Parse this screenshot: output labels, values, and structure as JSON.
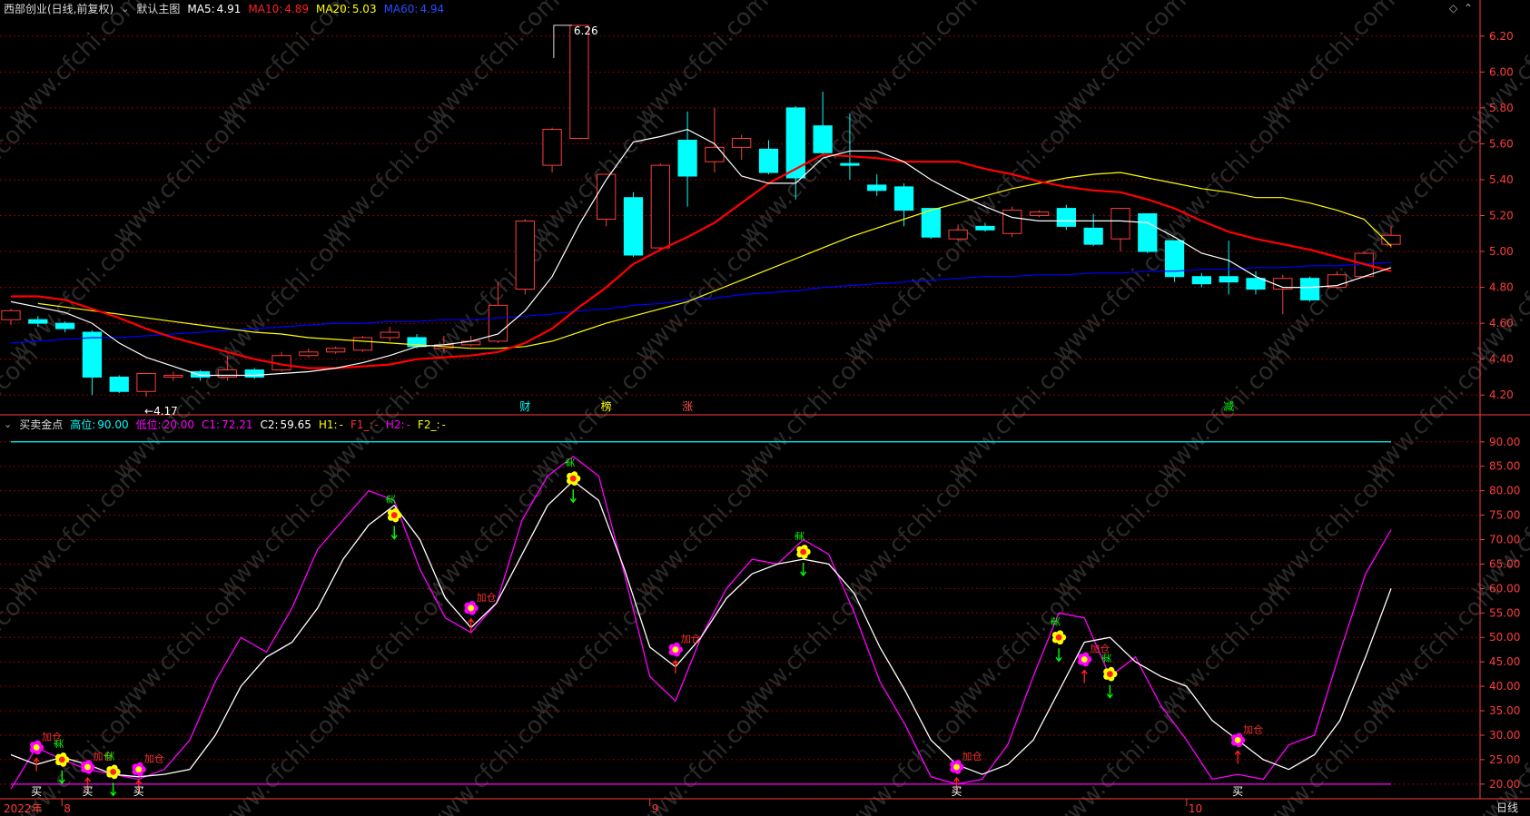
{
  "top_header": {
    "title": "西部创业(日线,前复权)",
    "chart_name": "默认主图",
    "ma5_label": "MA5:",
    "ma5_value": "4.91",
    "ma10_label": "MA10:",
    "ma10_value": "4.89",
    "ma20_label": "MA20:",
    "ma20_value": "5.03",
    "ma60_label": "MA60:",
    "ma60_value": "4.94"
  },
  "bottom_header": {
    "indicator_name": "买卖金点",
    "high_label": "高位:",
    "high_value": "90.00",
    "low_label": "低位:",
    "low_value": "20.00",
    "c1_label": "C1:",
    "c1_value": "72.21",
    "c2_label": "C2:",
    "c2_value": "59.65",
    "h1_label": "H1:",
    "h1_value": "-",
    "f1_label": "F1_:",
    "f1_value": "-",
    "h2_label": "H2:",
    "h2_value": "-",
    "f2_label": "F2_:",
    "f2_value": "-"
  },
  "colors": {
    "up": "#ff3c3c",
    "down": "#00ffff",
    "ma5": "#ffffff",
    "ma10": "#ff0000",
    "ma20": "#ffff00",
    "ma60": "#0000ff",
    "c1": "#ff00ff",
    "c2": "#ffffff",
    "high_line": "#00ffff",
    "low_line": "#ff00ff",
    "grid": "#8b0000",
    "axis": "#ff3c3c"
  },
  "chart_data": [
    {
      "type": "candlestick",
      "yaxis_ticks": [
        "6.20",
        "6.00",
        "5.80",
        "5.60",
        "5.40",
        "5.20",
        "5.00",
        "4.80",
        "4.60",
        "4.40",
        "4.20"
      ],
      "ylim": [
        4.1,
        6.3
      ],
      "max_annotation": "6.26",
      "min_annotation": "4.17",
      "candles": [
        [
          4.62,
          4.67,
          4.59,
          4.68
        ],
        [
          4.62,
          4.6,
          4.58,
          4.64
        ],
        [
          4.6,
          4.57,
          4.55,
          4.61
        ],
        [
          4.55,
          4.3,
          4.2,
          4.56
        ],
        [
          4.3,
          4.22,
          4.21,
          4.31
        ],
        [
          4.22,
          4.32,
          4.19,
          4.32
        ],
        [
          4.3,
          4.31,
          4.28,
          4.33
        ],
        [
          4.33,
          4.3,
          4.28,
          4.34
        ],
        [
          4.3,
          4.34,
          4.28,
          4.42
        ],
        [
          4.34,
          4.3,
          4.29,
          4.35
        ],
        [
          4.34,
          4.42,
          4.33,
          4.44
        ],
        [
          4.42,
          4.44,
          4.41,
          4.46
        ],
        [
          4.44,
          4.46,
          4.43,
          4.47
        ],
        [
          4.45,
          4.52,
          4.44,
          4.53
        ],
        [
          4.52,
          4.55,
          4.5,
          4.58
        ],
        [
          4.52,
          4.47,
          4.46,
          4.54
        ],
        [
          4.46,
          4.48,
          4.44,
          4.53
        ],
        [
          4.48,
          4.5,
          4.47,
          4.53
        ],
        [
          4.5,
          4.7,
          4.49,
          4.83
        ],
        [
          4.79,
          5.17,
          4.76,
          5.18
        ],
        [
          5.48,
          5.68,
          5.44,
          5.69
        ],
        [
          5.63,
          6.26,
          5.63,
          6.26
        ],
        [
          5.18,
          5.43,
          5.14,
          5.43
        ],
        [
          5.3,
          4.98,
          4.97,
          5.33
        ],
        [
          5.02,
          5.48,
          5.01,
          5.49
        ],
        [
          5.62,
          5.42,
          5.25,
          5.78
        ],
        [
          5.5,
          5.58,
          5.44,
          5.8
        ],
        [
          5.58,
          5.63,
          5.51,
          5.65
        ],
        [
          5.57,
          5.44,
          5.43,
          5.62
        ],
        [
          5.8,
          5.41,
          5.29,
          5.81
        ],
        [
          5.7,
          5.55,
          5.54,
          5.89
        ],
        [
          5.49,
          5.48,
          5.4,
          5.77
        ],
        [
          5.37,
          5.34,
          5.31,
          5.43
        ],
        [
          5.36,
          5.23,
          5.14,
          5.38
        ],
        [
          5.24,
          5.08,
          5.07,
          5.24
        ],
        [
          5.07,
          5.12,
          5.06,
          5.15
        ],
        [
          5.14,
          5.12,
          5.11,
          5.16
        ],
        [
          5.1,
          5.23,
          5.08,
          5.25
        ],
        [
          5.2,
          5.22,
          5.19,
          5.23
        ],
        [
          5.24,
          5.14,
          5.12,
          5.26
        ],
        [
          5.13,
          5.04,
          5.03,
          5.21
        ],
        [
          5.07,
          5.24,
          5.0,
          5.24
        ],
        [
          5.21,
          5.0,
          4.99,
          5.21
        ],
        [
          5.06,
          4.86,
          4.83,
          5.06
        ],
        [
          4.86,
          4.82,
          4.8,
          4.88
        ],
        [
          4.86,
          4.83,
          4.76,
          5.06
        ],
        [
          4.85,
          4.79,
          4.76,
          4.89
        ],
        [
          4.79,
          4.85,
          4.65,
          4.87
        ],
        [
          4.85,
          4.73,
          4.72,
          4.86
        ],
        [
          4.8,
          4.87,
          4.79,
          4.89
        ],
        [
          4.86,
          4.99,
          4.85,
          5.0
        ],
        [
          5.04,
          5.09,
          5.02,
          5.14
        ]
      ],
      "ma5": [
        4.72,
        4.69,
        4.66,
        4.6,
        4.49,
        4.41,
        4.36,
        4.31,
        4.31,
        4.31,
        4.32,
        4.33,
        4.35,
        4.38,
        4.42,
        4.47,
        4.48,
        4.5,
        4.54,
        4.67,
        4.86,
        5.15,
        5.4,
        5.61,
        5.64,
        5.68,
        5.6,
        5.42,
        5.38,
        5.38,
        5.52,
        5.56,
        5.56,
        5.5,
        5.4,
        5.32,
        5.25,
        5.19,
        5.17,
        5.17,
        5.17,
        5.17,
        5.16,
        5.08,
        4.99,
        4.95,
        4.86,
        4.8,
        4.8,
        4.81,
        4.86,
        4.91
      ],
      "ma10": [
        4.75,
        4.75,
        4.73,
        4.68,
        4.63,
        4.57,
        4.52,
        4.48,
        4.44,
        4.4,
        4.37,
        4.35,
        4.35,
        4.36,
        4.37,
        4.4,
        4.41,
        4.42,
        4.44,
        4.49,
        4.57,
        4.69,
        4.8,
        4.93,
        5.01,
        5.08,
        5.16,
        5.27,
        5.38,
        5.46,
        5.54,
        5.53,
        5.52,
        5.5,
        5.5,
        5.5,
        5.46,
        5.43,
        5.39,
        5.36,
        5.34,
        5.33,
        5.29,
        5.24,
        5.17,
        5.11,
        5.07,
        5.04,
        5.01,
        4.97,
        4.93,
        4.89
      ],
      "ma20": [
        null,
        4.71,
        4.69,
        4.67,
        4.65,
        4.63,
        4.61,
        4.59,
        4.57,
        4.55,
        4.54,
        4.52,
        4.51,
        4.5,
        4.49,
        4.48,
        4.47,
        4.46,
        4.46,
        4.47,
        4.5,
        4.55,
        4.6,
        4.64,
        4.68,
        4.72,
        4.78,
        4.84,
        4.9,
        4.96,
        5.02,
        5.08,
        5.13,
        5.18,
        5.23,
        5.27,
        5.31,
        5.35,
        5.38,
        5.41,
        5.43,
        5.44,
        5.41,
        5.38,
        5.35,
        5.33,
        5.3,
        5.3,
        5.27,
        5.23,
        5.18,
        5.03
      ],
      "ma60": [
        4.49,
        4.5,
        4.51,
        4.52,
        4.52,
        4.53,
        4.54,
        4.55,
        4.56,
        4.57,
        4.58,
        4.59,
        4.6,
        4.6,
        4.61,
        4.61,
        4.62,
        4.62,
        4.63,
        4.64,
        4.65,
        4.67,
        4.68,
        4.7,
        4.71,
        4.73,
        4.74,
        4.76,
        4.77,
        4.78,
        4.8,
        4.81,
        4.82,
        4.83,
        4.84,
        4.85,
        4.86,
        4.86,
        4.87,
        4.87,
        4.88,
        4.88,
        4.89,
        4.89,
        4.9,
        4.9,
        4.91,
        4.91,
        4.92,
        4.92,
        4.93,
        4.94
      ],
      "event_labels": [
        {
          "index": 19,
          "text": "财",
          "color": "#00ffff"
        },
        {
          "index": 22,
          "text": "榜",
          "color": "#ffff00"
        },
        {
          "index": 25,
          "text": "涨",
          "color": "#ff5050"
        },
        {
          "index": 45,
          "text": "减",
          "color": "#00ff00"
        }
      ]
    },
    {
      "type": "line",
      "yaxis_ticks": [
        "90.00",
        "85.00",
        "80.00",
        "75.00",
        "70.00",
        "65.00",
        "60.00",
        "55.00",
        "50.00",
        "45.00",
        "40.00",
        "35.00",
        "30.00",
        "25.00",
        "20.00"
      ],
      "ylim": [
        17,
        92
      ],
      "high_level": 90.0,
      "low_level": 20.0,
      "series": [
        {
          "name": "C1",
          "values": [
            19,
            27.5,
            25,
            23,
            22,
            21,
            23,
            29,
            41,
            50,
            47,
            56,
            68,
            74,
            80,
            78,
            64,
            54,
            51,
            57,
            74,
            83,
            87,
            83,
            63,
            42,
            37,
            50,
            60,
            66,
            65,
            70,
            67,
            55,
            41,
            32,
            21.5,
            20,
            21,
            28,
            42,
            55,
            54,
            42,
            46,
            36,
            29,
            21,
            22,
            21,
            28,
            30,
            47,
            63,
            72
          ]
        },
        {
          "name": "C2",
          "values": [
            26,
            24,
            25.5,
            24,
            22,
            21.5,
            22,
            23,
            30,
            40,
            46,
            49,
            56,
            66,
            73,
            77,
            70,
            58,
            52,
            57,
            67,
            77,
            82,
            78,
            64,
            48,
            44,
            50,
            58,
            63,
            65,
            66,
            65,
            59,
            48,
            39,
            29,
            24,
            22,
            24,
            29,
            39,
            49,
            50,
            45,
            42,
            40,
            33,
            29,
            25,
            23,
            26,
            33,
            46,
            60
          ]
        }
      ],
      "signals": [
        {
          "index": 1,
          "value": 27.5,
          "kind": "flower-magenta",
          "label": "加仓",
          "label_color": "#ff3030",
          "arrow": "up"
        },
        {
          "index": 2,
          "value": 25.0,
          "kind": "flower-yellow",
          "label": "卖",
          "label_color": "#00ff00",
          "arrow": "down"
        },
        {
          "index": 3,
          "value": 23.5,
          "kind": "flower-magenta",
          "label": "加仓",
          "label_color": "#ff3030",
          "arrow": "up"
        },
        {
          "index": 4,
          "value": 22.5,
          "kind": "flower-yellow",
          "label": "卖",
          "label_color": "#00ff00",
          "arrow": "down"
        },
        {
          "index": 5,
          "value": 23.0,
          "kind": "flower-magenta",
          "label": "加仓",
          "label_color": "#ff3030",
          "arrow": "up"
        },
        {
          "index": 15,
          "value": 75.0,
          "kind": "flower-yellow",
          "label": "卖",
          "label_color": "#00ff00",
          "arrow": "down"
        },
        {
          "index": 18,
          "value": 56.0,
          "kind": "flower-magenta",
          "label": "加仓",
          "label_color": "#ff3030",
          "arrow": "up"
        },
        {
          "index": 22,
          "value": 82.5,
          "kind": "flower-yellow",
          "label": "卖",
          "label_color": "#00ff00",
          "arrow": "down"
        },
        {
          "index": 26,
          "value": 47.5,
          "kind": "flower-magenta",
          "label": "加仓",
          "label_color": "#ff3030",
          "arrow": "up"
        },
        {
          "index": 31,
          "value": 67.5,
          "kind": "flower-yellow",
          "label": "卖",
          "label_color": "#00ff00",
          "arrow": "down"
        },
        {
          "index": 37,
          "value": 23.5,
          "kind": "flower-magenta",
          "label": "加仓",
          "label_color": "#ff3030",
          "arrow": "up"
        },
        {
          "index": 41,
          "value": 50.0,
          "kind": "flower-yellow",
          "label": "卖",
          "label_color": "#00ff00",
          "arrow": "down"
        },
        {
          "index": 42,
          "value": 45.5,
          "kind": "flower-magenta",
          "label": "加仓",
          "label_color": "#ff3030",
          "arrow": "up"
        },
        {
          "index": 43,
          "value": 42.5,
          "kind": "flower-yellow",
          "label": "卖",
          "label_color": "#00ff00",
          "arrow": "down"
        },
        {
          "index": 48,
          "value": 29.0,
          "kind": "flower-magenta",
          "label": "加仓",
          "label_color": "#ff3030",
          "arrow": "up"
        }
      ],
      "buy_marks": [
        1,
        3,
        5,
        37,
        48
      ],
      "buy_text": "买"
    }
  ],
  "xaxis": {
    "labels": [
      {
        "index": 0,
        "text": "2022年"
      },
      {
        "index": 2,
        "text": "8"
      },
      {
        "index": 25,
        "text": "9"
      },
      {
        "index": 46,
        "text": "10"
      }
    ]
  },
  "status": {
    "period": "日线"
  },
  "watermark": "www.cfchi.com"
}
